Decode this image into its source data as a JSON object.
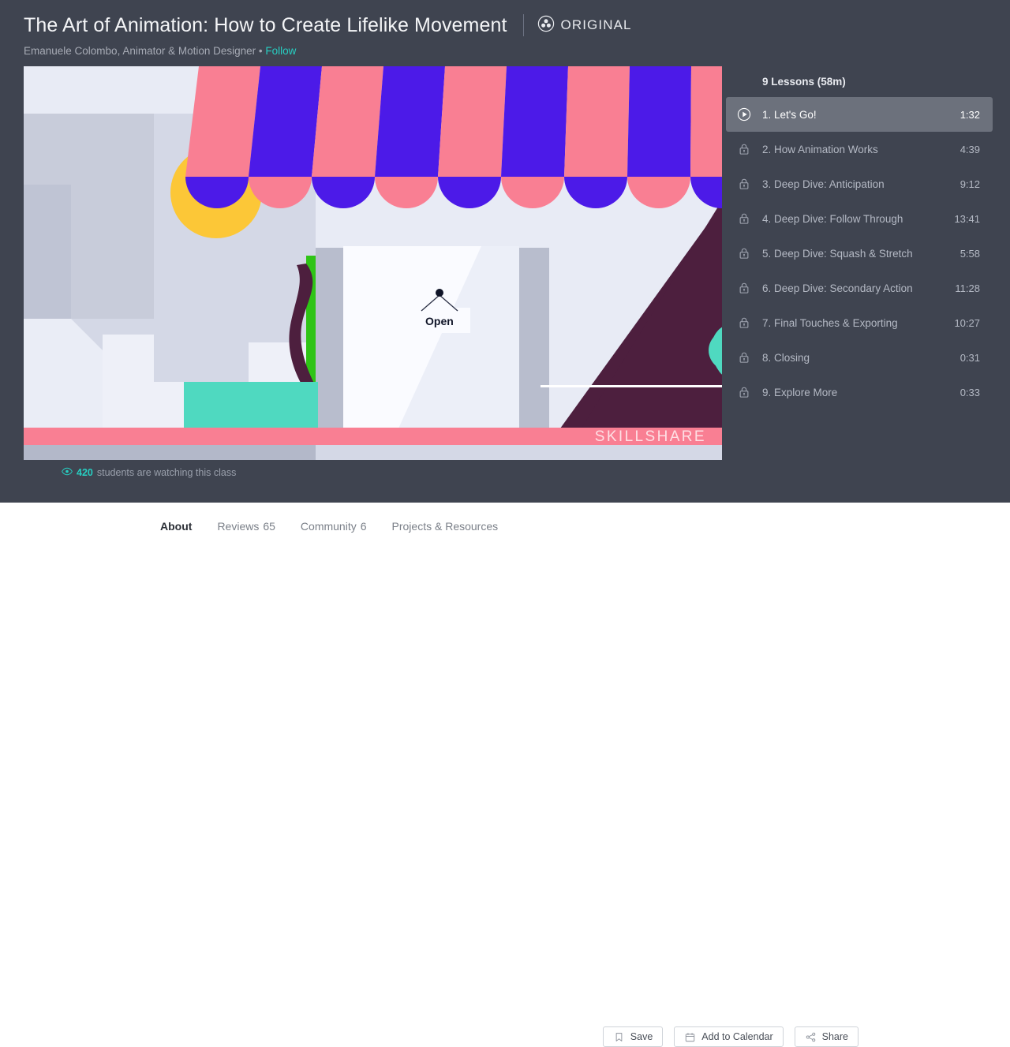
{
  "header": {
    "title": "The Art of Animation: How to Create Lifelike Movement",
    "badge_label": "ORIGINAL",
    "byline_text": "Emanuele Colombo, Animator & Motion Designer • ",
    "follow_label": "Follow"
  },
  "player": {
    "watermark": "SKILLSHARE",
    "open_sign_text": "Open",
    "watching_count": "420",
    "watching_text": " students are watching this class",
    "colors": {
      "sky": "#e8ebf5",
      "wall_light": "#eceff8",
      "wall_mid": "#d4d8e6",
      "wall_shadow": "#c6cad9",
      "pillar": "#b8bdcd",
      "awning_pink": "#f97f93",
      "awning_purple": "#4c1ae8",
      "sun_yellow": "#fcc737",
      "plant_green": "#2fc416",
      "stem_plum": "#4d1f3e",
      "counter_teal": "#4fd9c0",
      "curb_pink": "#f97f93",
      "ground": "#b3b8c9",
      "dark_plum": "#4d1f3e",
      "sign_white": "#fafbff",
      "ink": "#101528"
    }
  },
  "lessons_panel": {
    "heading": "9 Lessons (58m)",
    "items": [
      {
        "label": "1. Let's Go!",
        "time": "1:32",
        "icon": "play-icon",
        "state": "active"
      },
      {
        "label": "2. How Animation Works",
        "time": "4:39",
        "icon": "lock-icon",
        "state": "locked"
      },
      {
        "label": "3. Deep Dive: Anticipation",
        "time": "9:12",
        "icon": "lock-icon",
        "state": "locked"
      },
      {
        "label": "4. Deep Dive: Follow Through",
        "time": "13:41",
        "icon": "lock-icon",
        "state": "locked"
      },
      {
        "label": "5. Deep Dive: Squash & Stretch",
        "time": "5:58",
        "icon": "lock-icon",
        "state": "locked"
      },
      {
        "label": "6. Deep Dive: Secondary Action",
        "time": "11:28",
        "icon": "lock-icon",
        "state": "locked"
      },
      {
        "label": "7. Final Touches & Exporting",
        "time": "10:27",
        "icon": "lock-icon",
        "state": "locked"
      },
      {
        "label": "8. Closing",
        "time": "0:31",
        "icon": "lock-icon",
        "state": "locked"
      },
      {
        "label": "9. Explore More",
        "time": "0:33",
        "icon": "lock-icon",
        "state": "locked"
      }
    ]
  },
  "bottom_bar": {
    "tabs": [
      {
        "label": "About",
        "count": "",
        "active": true
      },
      {
        "label": "Reviews",
        "count": "65",
        "active": false
      },
      {
        "label": "Community",
        "count": "6",
        "active": false
      },
      {
        "label": "Projects & Resources",
        "count": "",
        "active": false
      }
    ],
    "buttons": [
      {
        "label": "Save",
        "icon": "bookmark-icon"
      },
      {
        "label": "Add to Calendar",
        "icon": "calendar-icon"
      },
      {
        "label": "Share",
        "icon": "share-icon"
      }
    ]
  },
  "theme": {
    "dark_bg": "#3f4450",
    "accent_teal": "#27cfc2",
    "active_row": "#6c717c"
  }
}
